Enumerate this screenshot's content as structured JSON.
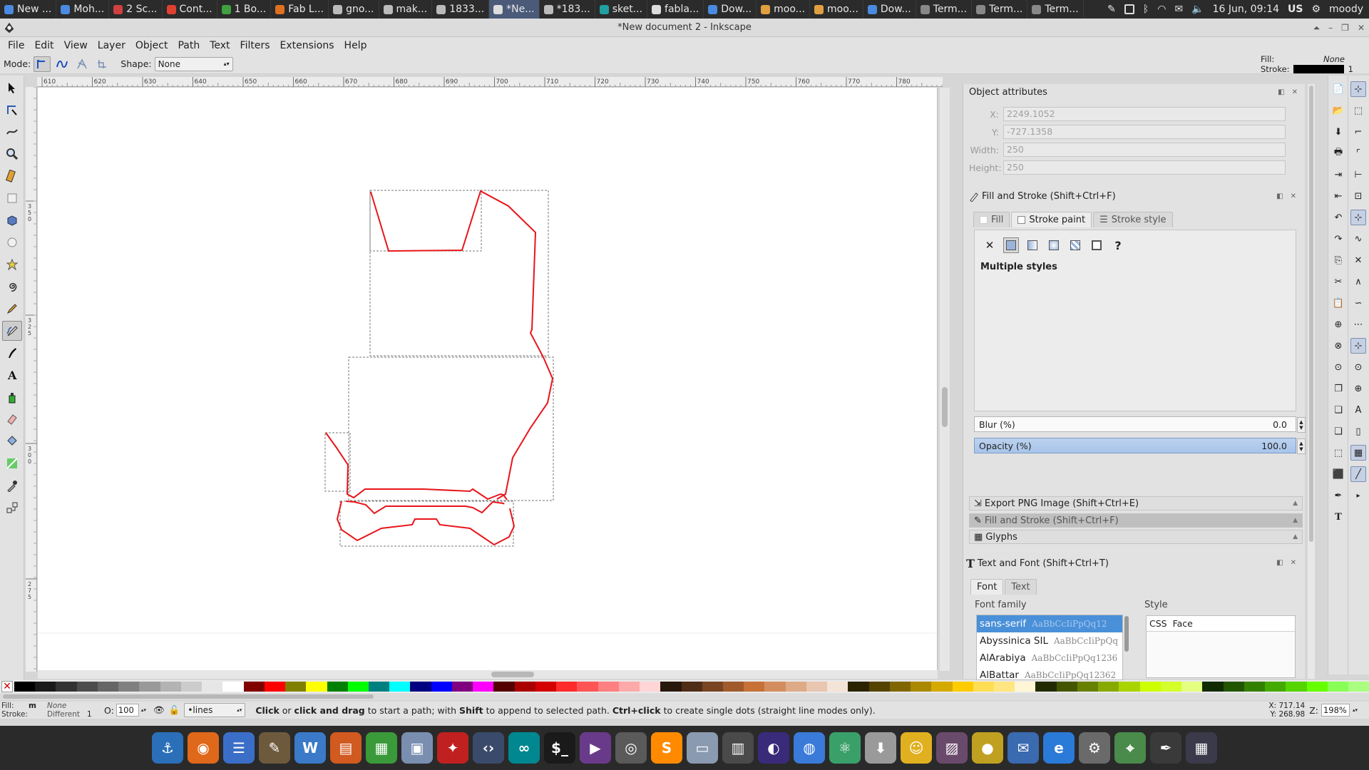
{
  "taskbar": {
    "tasks": [
      {
        "label": "New ...",
        "icon_color": "#4a8ae0",
        "active": false
      },
      {
        "label": "Moh...",
        "icon_color": "#4a8ae0",
        "active": false
      },
      {
        "label": "2 Sc...",
        "icon_color": "#d04040",
        "active": false
      },
      {
        "label": "Cont...",
        "icon_color": "#e04030",
        "active": false
      },
      {
        "label": "1 Bo...",
        "icon_color": "#40a040",
        "active": false
      },
      {
        "label": "Fab L...",
        "icon_color": "#e07020",
        "active": false
      },
      {
        "label": "gno...",
        "icon_color": "#bbbbbb",
        "active": false
      },
      {
        "label": "mak...",
        "icon_color": "#bbbbbb",
        "active": false
      },
      {
        "label": "1833...",
        "icon_color": "#bbbbbb",
        "active": false
      },
      {
        "label": "*Ne...",
        "icon_color": "#dddddd",
        "active": true
      },
      {
        "label": "*183...",
        "icon_color": "#bbbbbb",
        "active": false
      },
      {
        "label": "sket...",
        "icon_color": "#20a0a0",
        "active": false
      },
      {
        "label": "fabla...",
        "icon_color": "#dddddd",
        "active": false
      },
      {
        "label": "Dow...",
        "icon_color": "#4a8ae0",
        "active": false
      },
      {
        "label": "moo...",
        "icon_color": "#e0a040",
        "active": false
      },
      {
        "label": "moo...",
        "icon_color": "#e0a040",
        "active": false
      },
      {
        "label": "Dow...",
        "icon_color": "#4a8ae0",
        "active": false
      },
      {
        "label": "Term...",
        "icon_color": "#888888",
        "active": false
      },
      {
        "label": "Term...",
        "icon_color": "#888888",
        "active": false
      },
      {
        "label": "Term...",
        "icon_color": "#888888",
        "active": false
      }
    ],
    "datetime": "16 Jun, 09:14",
    "keyboard": "US",
    "user": "moody"
  },
  "window": {
    "title": "*New document 2 - Inkscape"
  },
  "menu": [
    "File",
    "Edit",
    "View",
    "Layer",
    "Object",
    "Path",
    "Text",
    "Filters",
    "Extensions",
    "Help"
  ],
  "toolcontrols": {
    "mode_label": "Mode:",
    "shape_label": "Shape:",
    "shape_value": "None"
  },
  "style_indicator": {
    "fill_label": "Fill:",
    "fill_value": "None",
    "stroke_label": "Stroke:",
    "stroke_width": "1",
    "stroke_color": "#000000"
  },
  "ruler": {
    "h_ticks": [
      "610",
      "620",
      "630",
      "640",
      "650",
      "660",
      "670",
      "680",
      "690",
      "700",
      "710",
      "720",
      "730",
      "740",
      "750",
      "760",
      "770",
      "780"
    ],
    "v_ticks": [
      "3\n5\n0",
      "3\n2\n5",
      "3\n0\n0",
      "2\n7\n5"
    ]
  },
  "object_attributes": {
    "title": "Object attributes",
    "x_label": "X:",
    "x_value": "2249.1052",
    "y_label": "Y:",
    "y_value": "-727.1358",
    "width_label": "Width:",
    "width_value": "250",
    "height_label": "Height:",
    "height_value": "250"
  },
  "fill_stroke": {
    "title": "Fill and Stroke (Shift+Ctrl+F)",
    "tabs": [
      "Fill",
      "Stroke paint",
      "Stroke style"
    ],
    "active_tab": "Stroke paint",
    "message": "Multiple styles",
    "blur_label": "Blur (%)",
    "blur_value": "0.0",
    "opacity_label": "Opacity (%)",
    "opacity_value": "100.0"
  },
  "collapsed_panels": [
    "Export PNG Image (Shift+Ctrl+E)",
    "Fill and Stroke (Shift+Ctrl+F)",
    "Glyphs"
  ],
  "text_font": {
    "title": "Text and Font (Shift+Ctrl+T)",
    "tabs": [
      "Font",
      "Text"
    ],
    "font_family_label": "Font family",
    "style_label": "Style",
    "fonts": [
      {
        "name": "sans-serif",
        "sample": "AaBbCcIiPpQq12",
        "selected": true
      },
      {
        "name": "Abyssinica SIL",
        "sample": "AaBbCcIiPpQq",
        "selected": false
      },
      {
        "name": "AlArabiya",
        "sample": "AaBbCcIiPpQq1236",
        "selected": false
      },
      {
        "name": "AlBattar",
        "sample": "AaBbCcIiPpQq12362",
        "selected": false
      }
    ],
    "style_columns": [
      "CSS",
      "Face"
    ]
  },
  "statusbar": {
    "fill_label": "Fill:",
    "fill_value": "None",
    "stroke_label": "Stroke:",
    "stroke_value": "Different",
    "stroke_width": "1",
    "opacity_label": "O:",
    "opacity_value": "100",
    "layer_value": "•lines",
    "message_parts": [
      {
        "text": "Click",
        "bold": true
      },
      {
        "text": " or ",
        "bold": false
      },
      {
        "text": "click and drag",
        "bold": true
      },
      {
        "text": " to start a path; with ",
        "bold": false
      },
      {
        "text": "Shift",
        "bold": true
      },
      {
        "text": " to append to selected path. ",
        "bold": false
      },
      {
        "text": "Ctrl+click",
        "bold": true
      },
      {
        "text": " to create single dots (straight line modes only).",
        "bold": false
      }
    ],
    "x_coord": "717.14",
    "y_coord": "268.98",
    "zoom_label": "Z:",
    "zoom_value": "198%"
  },
  "palette_colors": [
    "#000000",
    "#1a1a1a",
    "#333333",
    "#4d4d4d",
    "#666666",
    "#808080",
    "#999999",
    "#b3b3b3",
    "#cccccc",
    "#e6e6e6",
    "#ffffff",
    "#800000",
    "#ff0000",
    "#808000",
    "#ffff00",
    "#008000",
    "#00ff00",
    "#008080",
    "#00ffff",
    "#000080",
    "#0000ff",
    "#800080",
    "#ff00ff",
    "#550000",
    "#aa0000",
    "#d40000",
    "#ff2a2a",
    "#ff5555",
    "#ff8080",
    "#ffaaaa",
    "#ffd5d5",
    "#28170b",
    "#502d16",
    "#784421",
    "#a05a2c",
    "#c87137",
    "#d38d5f",
    "#deaa87",
    "#e9c6af",
    "#f4e3d7",
    "#2b2200",
    "#554400",
    "#806600",
    "#aa8800",
    "#d4aa00",
    "#ffcc00",
    "#ffdd55",
    "#ffe680",
    "#fff6d5",
    "#222b00",
    "#445500",
    "#668000",
    "#88aa00",
    "#aad400",
    "#ccff00",
    "#d4ff2a",
    "#e5ff80",
    "#112b00",
    "#225500",
    "#338000",
    "#44aa00",
    "#55d400",
    "#66ff00",
    "#87ff55",
    "#aaff80"
  ],
  "launcher_apps": [
    {
      "name": "anchor-app",
      "glyph": "⚓",
      "color": "#2a6fb8"
    },
    {
      "name": "firefox-app",
      "glyph": "◉",
      "color": "#e0681a"
    },
    {
      "name": "docs-app",
      "glyph": "☰",
      "color": "#3b6fc7"
    },
    {
      "name": "gimp-app",
      "glyph": "✎",
      "color": "#6d5a3d"
    },
    {
      "name": "wave-app",
      "glyph": "W",
      "color": "#3a7ac8"
    },
    {
      "name": "impress-app",
      "glyph": "▤",
      "color": "#d05a20"
    },
    {
      "name": "calc-app",
      "glyph": "▦",
      "color": "#3a9a3a"
    },
    {
      "name": "archive-app",
      "glyph": "▣",
      "color": "#7a8fb0"
    },
    {
      "name": "inkscape-red-app",
      "glyph": "✦",
      "color": "#c02020"
    },
    {
      "name": "code-app",
      "glyph": "‹›",
      "color": "#3a4a6a"
    },
    {
      "name": "arduino-app",
      "glyph": "∞",
      "color": "#00878f"
    },
    {
      "name": "terminal-app",
      "glyph": "$_",
      "color": "#1a1a1a"
    },
    {
      "name": "video-app",
      "glyph": "▶",
      "color": "#6a3a8a"
    },
    {
      "name": "camera-app",
      "glyph": "◎",
      "color": "#5a5a5a"
    },
    {
      "name": "sublime-app",
      "glyph": "S",
      "color": "#ff8a00"
    },
    {
      "name": "windows-app",
      "glyph": "▭",
      "color": "#8a9ab0"
    },
    {
      "name": "calculator-app",
      "glyph": "▥",
      "color": "#4a4a4a"
    },
    {
      "name": "eclipse-app",
      "glyph": "◐",
      "color": "#3a2a7a"
    },
    {
      "name": "chrome-app",
      "glyph": "◍",
      "color": "#3a7ad8"
    },
    {
      "name": "atom-app",
      "glyph": "⚛",
      "color": "#3aa06a"
    },
    {
      "name": "installer-app",
      "glyph": "⬇",
      "color": "#9a9a9a"
    },
    {
      "name": "emoji-app",
      "glyph": "☺",
      "color": "#e0b020"
    },
    {
      "name": "photos-app",
      "glyph": "▨",
      "color": "#6a4a6a"
    },
    {
      "name": "ball-app",
      "glyph": "●",
      "color": "#c0a020"
    },
    {
      "name": "thunderbird-app",
      "glyph": "✉",
      "color": "#3a6ab0"
    },
    {
      "name": "ie-app",
      "glyph": "e",
      "color": "#2a7ad8"
    },
    {
      "name": "settings-app",
      "glyph": "⚙",
      "color": "#6a6a6a"
    },
    {
      "name": "maps-app",
      "glyph": "⌖",
      "color": "#4a8a4a"
    },
    {
      "name": "inkscape-app",
      "glyph": "✒",
      "color": "#3a3a3a"
    },
    {
      "name": "workspace-app",
      "glyph": "▦",
      "color": "#3a3a4a"
    }
  ]
}
